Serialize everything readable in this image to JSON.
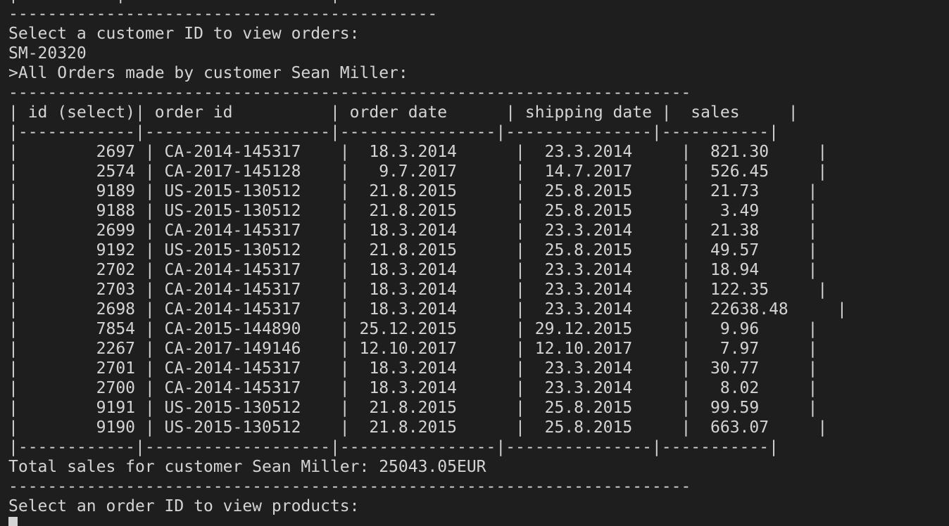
{
  "terminal": {
    "lines": [
      "|          |                     |",
      "--------------------------------------------",
      "Select a customer ID to view orders:",
      "SM-20320",
      ">All Orders made by customer Sean Miller:",
      "----------------------------------------------------------------------",
      "| id (select)| order id          | order date      | shipping date |  sales     |",
      "|------------|-------------------|----------------|---------------|-----------|",
      "|        2697 | CA-2014-145317    |  18.3.2014      |  23.3.2014     |  821.30     |",
      "|        2574 | CA-2017-145128    |   9.7.2017      |  14.7.2017     |  526.45     |",
      "|        9189 | US-2015-130512    |  21.8.2015      |  25.8.2015     |  21.73     |",
      "|        9188 | US-2015-130512    |  21.8.2015      |  25.8.2015     |   3.49     |",
      "|        2699 | CA-2014-145317    |  18.3.2014      |  23.3.2014     |  21.38     |",
      "|        9192 | US-2015-130512    |  21.8.2015      |  25.8.2015     |  49.57     |",
      "|        2702 | CA-2014-145317    |  18.3.2014      |  23.3.2014     |  18.94     |",
      "|        2703 | CA-2014-145317    |  18.3.2014      |  23.3.2014     |  122.35     |",
      "|        2698 | CA-2014-145317    |  18.3.2014      |  23.3.2014     |  22638.48     |",
      "|        7854 | CA-2015-144890    | 25.12.2015      | 29.12.2015     |   9.96     |",
      "|        2267 | CA-2017-149146    | 12.10.2017      | 12.10.2017     |   7.97     |",
      "|        2701 | CA-2014-145317    |  18.3.2014      |  23.3.2014     |  30.77     |",
      "|        2700 | CA-2014-145317    |  18.3.2014      |  23.3.2014     |   8.02     |",
      "|        9191 | US-2015-130512    |  21.8.2015      |  25.8.2015     |  99.59     |",
      "|        9190 | US-2015-130512    |  21.8.2015      |  25.8.2015     |  663.07     |",
      "|------------|-------------------|----------------|---------------|-----------|",
      "Total sales for customer Sean Miller: 25043.05EUR",
      "----------------------------------------------------------------------",
      "Select an order ID to view products:"
    ]
  }
}
